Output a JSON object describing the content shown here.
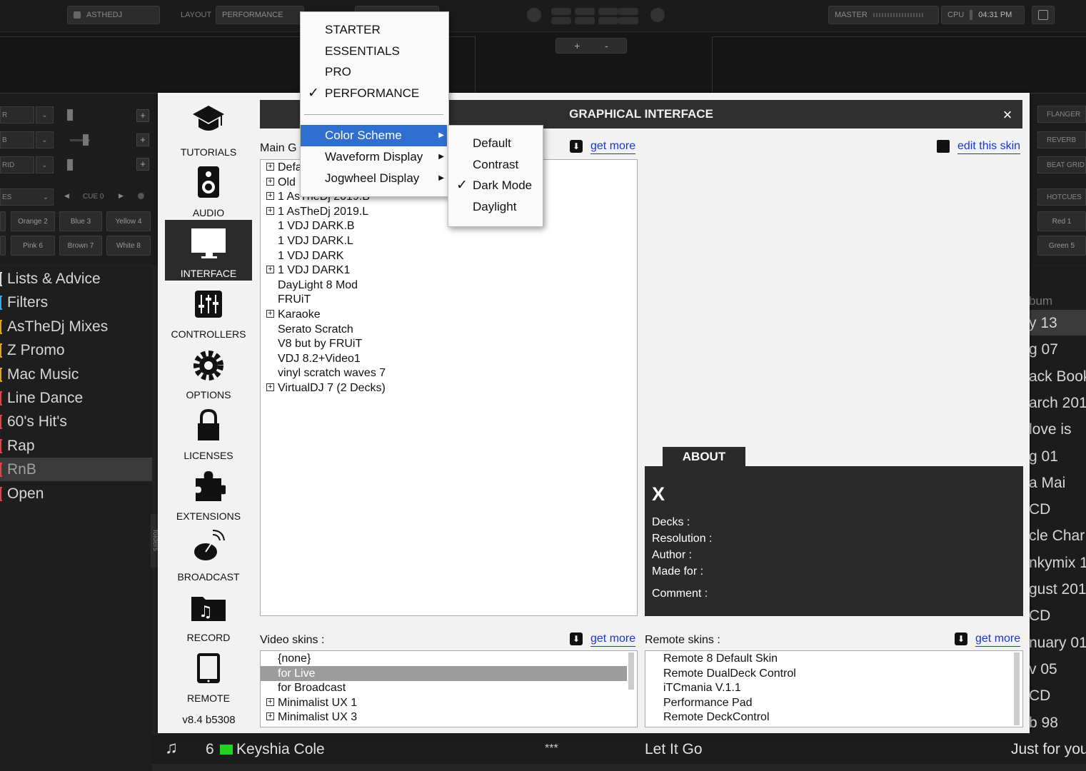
{
  "topbar": {
    "user": "ASTHEDJ",
    "layout_label": "LAYOUT",
    "layout_value": "PERFORMANCE",
    "master_label": "MASTER",
    "cpu_label": "CPU",
    "time": "04:31 PM",
    "deck_plus": "+",
    "deck_minus": "-"
  },
  "mixer": {
    "row_labels": [
      "R",
      "B",
      "RID",
      "ES"
    ],
    "cue_label": "CUE 0",
    "hotcues_left": [
      "Orange 2",
      "Blue 3",
      "Yellow 4",
      "Pink 6",
      "Brown 7",
      "White 8"
    ]
  },
  "right_effects": [
    "FLANGER",
    "REVERB",
    "BEAT GRID",
    "HOTCUES"
  ],
  "right_hotcues": [
    "Red 1",
    "Green 5"
  ],
  "folders": [
    {
      "label": "Lists & Advice",
      "color": "#d8d8d8"
    },
    {
      "label": "Filters",
      "color": "#3aa8e0"
    },
    {
      "label": "AsTheDj  Mixes",
      "color": "#e0a21b"
    },
    {
      "label": "Z Promo",
      "color": "#e0a21b"
    },
    {
      "label": "Mac Music",
      "color": "#e0a21b"
    },
    {
      "label": "Line Dance",
      "color": "#e04545"
    },
    {
      "label": "60's Hit's",
      "color": "#e04545"
    },
    {
      "label": "Rap",
      "color": "#e04545"
    },
    {
      "label": "RnB",
      "color": "#e04545"
    },
    {
      "label": "Open",
      "color": "#e04545"
    }
  ],
  "folders_tab": "folders",
  "right_browser": {
    "header": "bum",
    "rows": [
      "y 13",
      "g 07",
      "ack Book",
      "arch 2014",
      "love is",
      "g 01",
      "a Mai",
      "CD",
      "cle Char",
      "nkymix 1",
      "gust 201",
      "CD",
      "nuary 01",
      "v 05",
      "CD",
      "b 98"
    ]
  },
  "bottom_row": {
    "number": "6",
    "artist": "Keyshia Cole",
    "stars": "***",
    "title": "Let It Go",
    "album": "Just for you"
  },
  "dialog": {
    "title": "GRAPHICAL INTERFACE",
    "close": "×",
    "nav": [
      {
        "label": "TUTORIALS",
        "icon": "graduation-cap-icon"
      },
      {
        "label": "AUDIO",
        "icon": "speaker-icon"
      },
      {
        "label": "INTERFACE",
        "icon": "monitor-icon"
      },
      {
        "label": "CONTROLLERS",
        "icon": "sliders-icon"
      },
      {
        "label": "OPTIONS",
        "icon": "gear-icon"
      },
      {
        "label": "LICENSES",
        "icon": "lock-icon"
      },
      {
        "label": "EXTENSIONS",
        "icon": "puzzle-icon"
      },
      {
        "label": "BROADCAST",
        "icon": "satellite-dish-icon"
      },
      {
        "label": "RECORD",
        "icon": "music-folder-icon"
      },
      {
        "label": "REMOTE",
        "icon": "tablet-icon"
      }
    ],
    "version": "v8.4 b5308",
    "main_label": "Main G",
    "get_more": "get more",
    "edit_skin": "edit this skin",
    "main_skins": [
      {
        "label": "Defa",
        "exp": true
      },
      {
        "label": "Old",
        "exp": true
      },
      {
        "label": "1 AsTheDj 2019.B",
        "exp": true
      },
      {
        "label": "1 AsTheDj 2019.L",
        "exp": true
      },
      {
        "label": "1 VDJ DARK.B",
        "exp": false
      },
      {
        "label": "1 VDJ DARK.L",
        "exp": false
      },
      {
        "label": "1 VDJ DARK",
        "exp": false
      },
      {
        "label": "1 VDJ DARK1",
        "exp": true
      },
      {
        "label": "DayLight 8 Mod",
        "exp": false
      },
      {
        "label": "FRUiT",
        "exp": false
      },
      {
        "label": "Karaoke",
        "exp": true
      },
      {
        "label": "Serato Scratch",
        "exp": false
      },
      {
        "label": "V8 but by FRUiT",
        "exp": false
      },
      {
        "label": "VDJ 8.2+Video1",
        "exp": false
      },
      {
        "label": "vinyl scratch waves 7",
        "exp": false
      },
      {
        "label": "VirtualDJ 7 (2 Decks)",
        "exp": true
      }
    ],
    "about": {
      "tab": "ABOUT",
      "name": "X",
      "decks": "Decks :",
      "resolution": "Resolution :",
      "author": "Author :",
      "made_for": "Made for :",
      "comment": "Comment :"
    },
    "video_label": "Video skins :",
    "video_skins": [
      {
        "label": "{none}",
        "exp": false,
        "sel": false
      },
      {
        "label": "for Live",
        "exp": false,
        "sel": true
      },
      {
        "label": "for Broadcast",
        "exp": false,
        "sel": false
      },
      {
        "label": "Minimalist UX 1",
        "exp": true,
        "sel": false
      },
      {
        "label": "Minimalist UX 3",
        "exp": true,
        "sel": false
      }
    ],
    "remote_label": "Remote skins :",
    "remote_skins": [
      "Remote 8 Default Skin",
      "Remote DualDeck Control",
      "iTCmania V.1.1",
      "Performance Pad",
      "Remote DeckControl"
    ]
  },
  "layout_menu": {
    "items": [
      {
        "label": "STARTER",
        "checked": false
      },
      {
        "label": "ESSENTIALS",
        "checked": false
      },
      {
        "label": "PRO",
        "checked": false
      },
      {
        "label": "PERFORMANCE",
        "checked": true
      }
    ],
    "submenus": [
      "Color Scheme",
      "Waveform Display",
      "Jogwheel Display"
    ],
    "highlighted": "Color Scheme",
    "check_glyph": "✓",
    "arrow_glyph": "▶"
  },
  "color_menu": {
    "items": [
      {
        "label": "Default",
        "checked": false
      },
      {
        "label": "Contrast",
        "checked": false
      },
      {
        "label": "Dark Mode",
        "checked": true
      },
      {
        "label": "Daylight",
        "checked": false
      }
    ]
  },
  "colors": {
    "highlight": "#2f6fd0",
    "link": "#1a37c9",
    "green_tag": "#22d422"
  }
}
